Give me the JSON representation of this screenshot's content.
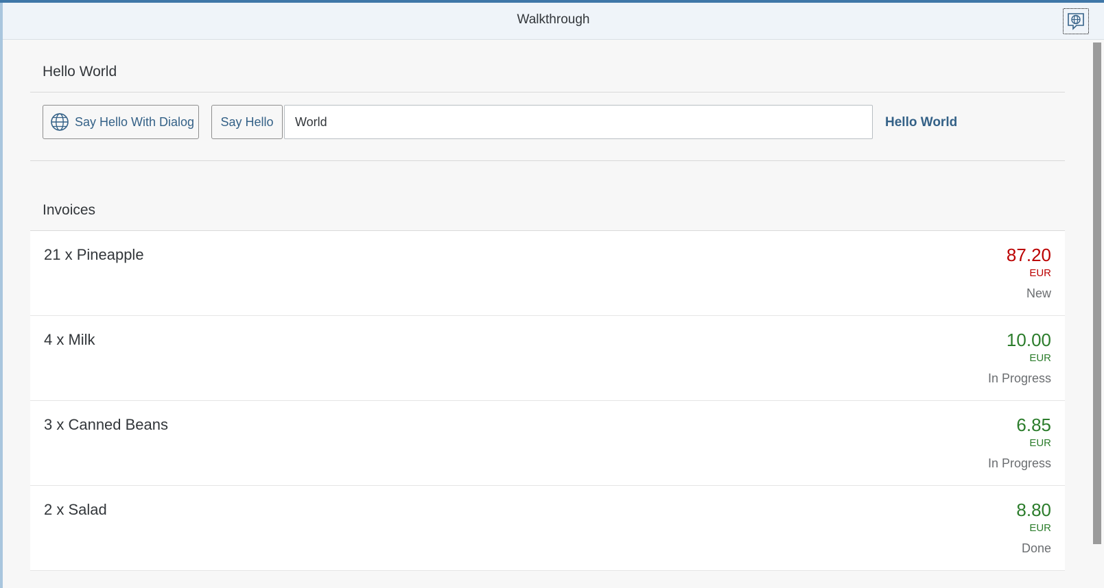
{
  "shell": {
    "title": "Walkthrough"
  },
  "hello_panel": {
    "title": "Hello World",
    "dialog_button_label": "Say Hello With Dialog",
    "say_hello_label": "Say Hello",
    "input_value": "World",
    "output_text": "Hello World"
  },
  "invoices": {
    "title": "Invoices",
    "items": [
      {
        "title": "21 x Pineapple",
        "amount": "87.20",
        "currency": "EUR",
        "status": "New",
        "state": "negative"
      },
      {
        "title": "4 x Milk",
        "amount": "10.00",
        "currency": "EUR",
        "status": "In Progress",
        "state": "positive"
      },
      {
        "title": "3 x Canned Beans",
        "amount": "6.85",
        "currency": "EUR",
        "status": "In Progress",
        "state": "positive"
      },
      {
        "title": "2 x Salad",
        "amount": "8.80",
        "currency": "EUR",
        "status": "Done",
        "state": "positive"
      }
    ]
  },
  "colors": {
    "negative": "#bb0000",
    "positive": "#2b7c2b",
    "accent": "#346187"
  }
}
